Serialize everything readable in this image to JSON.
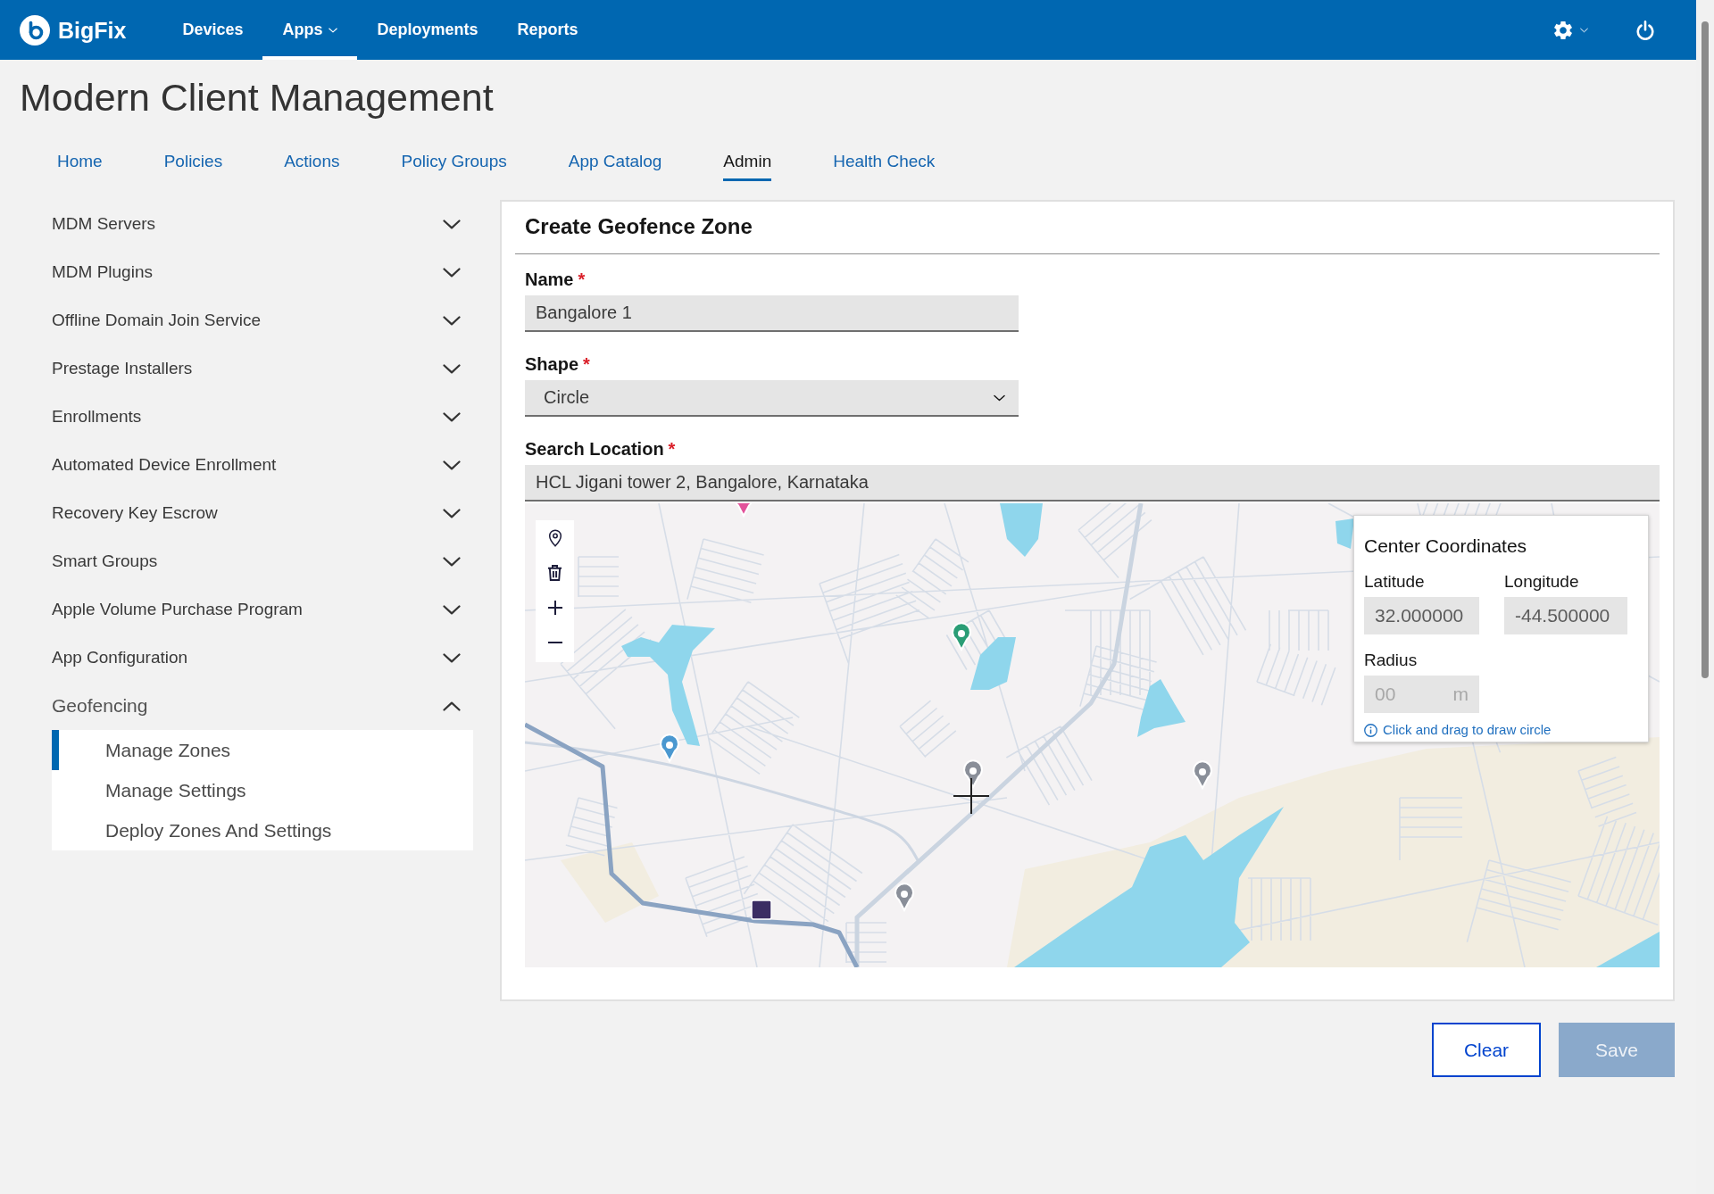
{
  "top_bar": {
    "logo": "BigFix",
    "nav": [
      {
        "label": "Devices",
        "selected": false,
        "dropdown": false
      },
      {
        "label": "Apps",
        "selected": true,
        "dropdown": true
      },
      {
        "label": "Deployments",
        "selected": false,
        "dropdown": false
      },
      {
        "label": "Reports",
        "selected": false,
        "dropdown": false
      }
    ]
  },
  "page_title": "Modern Client Management",
  "tabs": [
    {
      "label": "Home",
      "selected": false
    },
    {
      "label": "Policies",
      "selected": false
    },
    {
      "label": "Actions",
      "selected": false
    },
    {
      "label": "Policy Groups",
      "selected": false
    },
    {
      "label": "App Catalog",
      "selected": false
    },
    {
      "label": "Admin",
      "selected": true
    },
    {
      "label": "Health Check",
      "selected": false
    }
  ],
  "sidebar": {
    "items": [
      {
        "label": "MDM Servers",
        "expanded": false
      },
      {
        "label": "MDM Plugins",
        "expanded": false
      },
      {
        "label": "Offline Domain Join Service",
        "expanded": false
      },
      {
        "label": "Prestage Installers",
        "expanded": false
      },
      {
        "label": "Enrollments",
        "expanded": false
      },
      {
        "label": "Automated Device Enrollment",
        "expanded": false
      },
      {
        "label": "Recovery Key Escrow",
        "expanded": false
      },
      {
        "label": "Smart Groups",
        "expanded": false
      },
      {
        "label": "Apple Volume Purchase Program",
        "expanded": false
      },
      {
        "label": "App Configuration",
        "expanded": false
      },
      {
        "label": "Geofencing",
        "expanded": true,
        "children": [
          {
            "label": "Manage Zones",
            "selected": true
          },
          {
            "label": "Manage Settings",
            "selected": false
          },
          {
            "label": "Deploy Zones And Settings",
            "selected": false
          }
        ]
      }
    ]
  },
  "form": {
    "title": "Create Geofence Zone",
    "fields": [
      {
        "kind": "text",
        "label": "Name",
        "required_mark": "*",
        "value": "Bangalore 1"
      },
      {
        "kind": "select",
        "label": "Shape",
        "required_mark": "*",
        "value": "Circle"
      },
      {
        "kind": "search",
        "label": "Search Location",
        "required_mark": "*",
        "value": "HCL Jigani tower 2, Bangalore, Karnataka"
      }
    ],
    "map": {
      "coordinates_panel": {
        "title": "Center Coordinates",
        "fields": [
          {
            "label": "Latitude",
            "value": "32.000000",
            "disabled": true
          },
          {
            "label": "Longitude",
            "value": "-44.500000",
            "disabled": true
          },
          {
            "label": "Radius",
            "placeholder": "00",
            "unit": "m",
            "disabled": true
          }
        ],
        "hint": "Click and drag to draw circle"
      }
    }
  },
  "buttons": [
    {
      "label": "Clear",
      "kind": "secondary",
      "disabled": false
    },
    {
      "label": "Save",
      "kind": "primary",
      "disabled": true
    }
  ]
}
